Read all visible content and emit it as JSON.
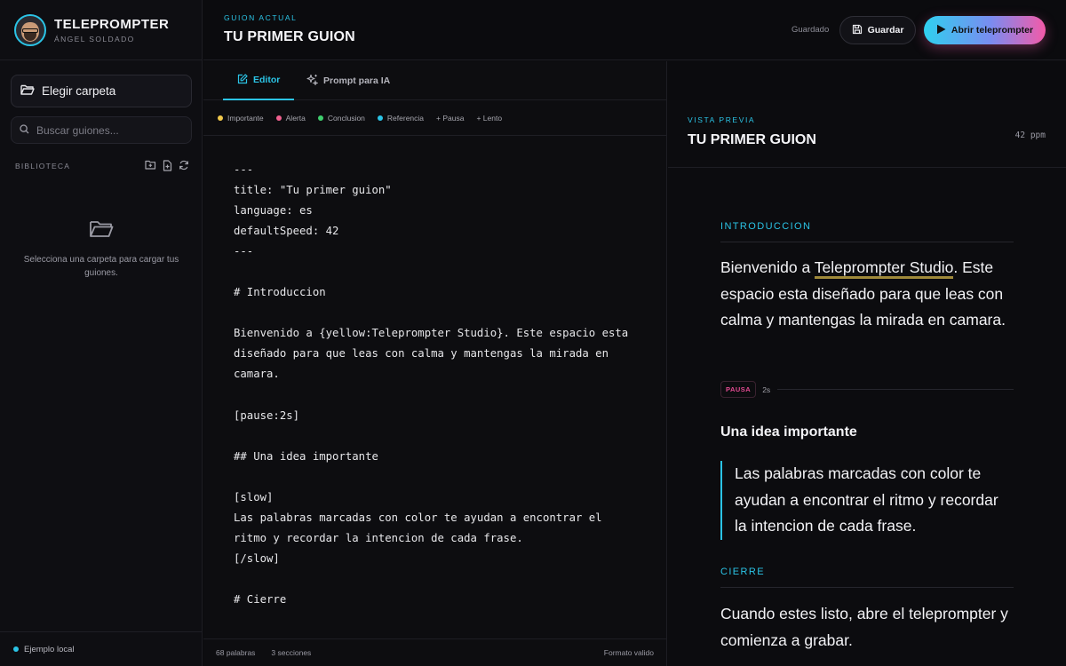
{
  "sidebar": {
    "app_name": "TELEPROMPTER",
    "user_name": "ÁNGEL SOLDADO",
    "choose_folder_label": "Elegir carpeta",
    "search_placeholder": "Buscar guiones...",
    "library_label": "BIBLIOTECA",
    "empty_message": "Selecciona una carpeta para cargar tus guiones.",
    "footer_status": "Ejemplo local",
    "icons": [
      "folder-open-icon",
      "search-icon",
      "new-folder-icon",
      "new-file-icon",
      "refresh-icon",
      "folder-icon"
    ]
  },
  "header": {
    "kicker": "GUION ACTUAL",
    "title": "TU PRIMER GUION",
    "status": "Guardado",
    "save_label": "Guardar",
    "open_label": "Abrir teleprompter"
  },
  "tabs": [
    {
      "label": "Editor",
      "active": true,
      "icon": "edit-icon"
    },
    {
      "label": "Prompt para IA",
      "active": false,
      "icon": "sparkle-icon"
    }
  ],
  "legend": [
    {
      "label": "Importante",
      "color": "#f2c94c"
    },
    {
      "label": "Alerta",
      "color": "#f0608f"
    },
    {
      "label": "Conclusion",
      "color": "#3fcf6e"
    },
    {
      "label": "Referencia",
      "color": "#2bc4e6"
    },
    {
      "label": "+ Pausa"
    },
    {
      "label": "+ Lento"
    }
  ],
  "editor": {
    "code": "---\ntitle: \"Tu primer guion\"\nlanguage: es\ndefaultSpeed: 42\n---\n\n# Introduccion\n\nBienvenido a {yellow:Teleprompter Studio}. Este espacio esta\ndiseñado para que leas con calma y mantengas la mirada en\ncamara.\n\n[pause:2s]\n\n## Una idea importante\n\n[slow]\nLas palabras marcadas con color te ayudan a encontrar el\nritmo y recordar la intencion de cada frase.\n[/slow]\n\n# Cierre",
    "word_count": "68 palabras",
    "section_count": "3 secciones",
    "format_status": "Formato valido"
  },
  "preview": {
    "kicker": "VISTA PREVIA",
    "title": "TU PRIMER GUION",
    "speed": "42 ppm",
    "intro_label": "INTRODUCCION",
    "intro_pre": "Bienvenido a ",
    "intro_highlight": "Teleprompter Studio",
    "intro_post": ". Este espacio esta diseñado para que leas con calma y mantengas la mirada en camara.",
    "pause_label": "PAUSA",
    "pause_time": "2s",
    "subheading": "Una idea importante",
    "quote": "Las palabras marcadas con color te ayudan a encontrar el ritmo y recordar la intencion de cada frase.",
    "closing_label": "CIERRE",
    "closing_text": "Cuando estes listo, abre el teleprompter y comienza a grabar."
  },
  "colors": {
    "accent": "#2bc4e6",
    "pink": "#f45aa8",
    "background": "#0b0b0e"
  }
}
